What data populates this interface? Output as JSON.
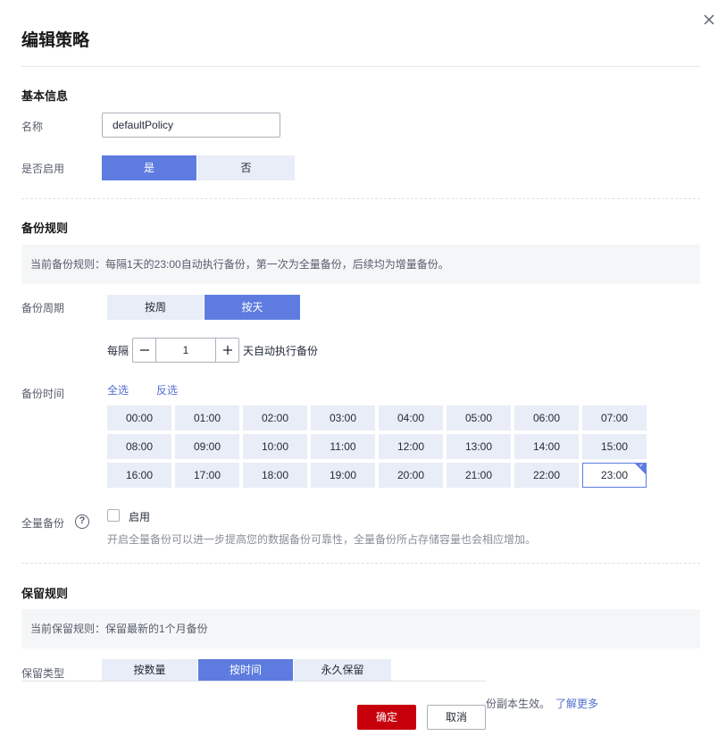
{
  "dialog": {
    "title": "编辑策略",
    "close_icon": "close-icon"
  },
  "basic": {
    "section_title": "基本信息",
    "name_label": "名称",
    "name_value": "defaultPolicy",
    "enable_label": "是否启用",
    "enable_options": [
      "是",
      "否"
    ],
    "enable_selected": "是"
  },
  "backup_rule": {
    "section_title": "备份规则",
    "current_rule": "当前备份规则：每隔1天的23:00自动执行备份，第一次为全量备份，后续均为增量备份。",
    "period_label": "备份周期",
    "period_options": [
      "按周",
      "按天"
    ],
    "period_selected": "按天",
    "interval_prefix": "每隔",
    "interval_value": "1",
    "interval_suffix": "天自动执行备份",
    "time_label": "备份时间",
    "select_all": "全选",
    "invert_select": "反选",
    "hours": [
      "00:00",
      "01:00",
      "02:00",
      "03:00",
      "04:00",
      "05:00",
      "06:00",
      "07:00",
      "08:00",
      "09:00",
      "10:00",
      "11:00",
      "12:00",
      "13:00",
      "14:00",
      "15:00",
      "16:00",
      "17:00",
      "18:00",
      "19:00",
      "20:00",
      "21:00",
      "22:00",
      "23:00"
    ],
    "selected_hours": [
      "23:00"
    ],
    "full_backup_label": "全量备份",
    "full_backup_checkbox_label": "启用",
    "full_backup_checked": false,
    "full_backup_hint": "开启全量备份可以进一步提高您的数据备份可靠性，全量备份所占存储容量也会相应增加。"
  },
  "retention_rule": {
    "section_title": "保留规则",
    "current_rule": "当前保留规则：保留最新的1个月备份",
    "type_label": "保留类型",
    "type_options": [
      "按数量",
      "按时间",
      "永久保留"
    ],
    "type_selected": "按时间"
  },
  "footer": {
    "partial_text": "份副本生效。",
    "learn_more": "了解更多",
    "confirm": "确定",
    "cancel": "取消"
  },
  "colors": {
    "primary": "#5e7ce0",
    "danger": "#c7000b",
    "link": "#526ecc"
  }
}
